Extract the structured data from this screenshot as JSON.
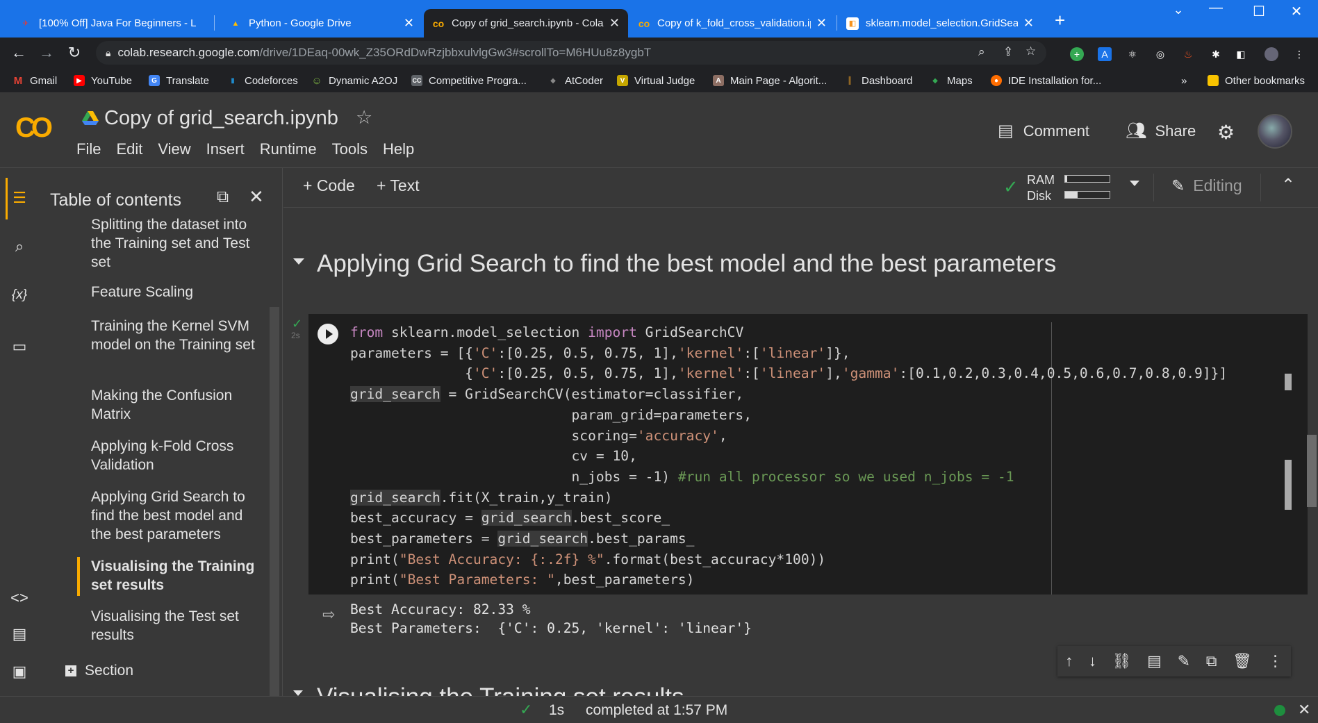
{
  "browser": {
    "tabs": [
      {
        "title": "[100% Off] Java For Beginners - L",
        "icon": "udemy-icon",
        "color": "#e53935",
        "glyph": "✈"
      },
      {
        "title": "Python - Google Drive",
        "icon": "google-drive-icon",
        "color": "#fbbc04",
        "glyph": "▲"
      },
      {
        "title": "Copy of grid_search.ipynb - Colab",
        "icon": "colab-icon",
        "color": "#f9ab00",
        "glyph": "co"
      },
      {
        "title": "Copy of k_fold_cross_validation.ip",
        "icon": "colab-icon",
        "color": "#f9ab00",
        "glyph": "co"
      },
      {
        "title": "sklearn.model_selection.GridSear",
        "icon": "sklearn-icon",
        "color": "#f7931e",
        "glyph": "◧"
      }
    ],
    "url_host": "colab.research.google.com",
    "url_path": "/drive/1DEaq-00wk_Z35ORdDwRzjbbxulvlgGw3#scrollTo=M6HUu8z8ygbT",
    "bookmarks": [
      {
        "label": "Gmail",
        "icon": "gmail-icon",
        "color": "#ea4335",
        "glyph": "M"
      },
      {
        "label": "YouTube",
        "icon": "youtube-icon",
        "color": "#ff0000",
        "glyph": "▶"
      },
      {
        "label": "Translate",
        "icon": "translate-icon",
        "color": "#4285f4",
        "glyph": "G"
      },
      {
        "label": "Codeforces",
        "icon": "codeforces-icon",
        "color": "#1f8acb",
        "glyph": "▮"
      },
      {
        "label": "Dynamic A2OJ",
        "icon": "a2oj-icon",
        "color": "#7cb342",
        "glyph": "☺"
      },
      {
        "label": "Competitive Progra...",
        "icon": "cp-icon",
        "color": "#5f6368",
        "glyph": "CC"
      },
      {
        "label": "AtCoder",
        "icon": "atcoder-icon",
        "color": "#444",
        "glyph": "◆"
      },
      {
        "label": "Virtual Judge",
        "icon": "vjudge-icon",
        "color": "#c6a700",
        "glyph": "V"
      },
      {
        "label": "Main Page - Algorit...",
        "icon": "algorithmica-icon",
        "color": "#8d6e63",
        "glyph": "A"
      },
      {
        "label": "Dashboard",
        "icon": "dashboard-icon",
        "color": "#f9a825",
        "glyph": "║"
      },
      {
        "label": "Maps",
        "icon": "maps-icon",
        "color": "#34a853",
        "glyph": "◆"
      },
      {
        "label": "IDE Installation for...",
        "icon": "ide-icon",
        "color": "#ff6d00",
        "glyph": "●"
      }
    ],
    "bookmarks_more": "»",
    "other_bookmarks": "Other bookmarks"
  },
  "colab": {
    "notebook_title": "Copy of grid_search.ipynb",
    "menu": [
      "File",
      "Edit",
      "View",
      "Insert",
      "Runtime",
      "Tools",
      "Help"
    ],
    "comment_label": "Comment",
    "share_label": "Share",
    "add_code": "+ Code",
    "add_text": "+ Text",
    "ram_label": "RAM",
    "disk_label": "Disk",
    "ram_usage": 0.05,
    "disk_usage": 0.28,
    "editing_label": "Editing"
  },
  "toc": {
    "title": "Table of contents",
    "items": [
      "Splitting the dataset into the Training set and Test set",
      "Feature Scaling",
      "Training the Kernel SVM model on the Training set",
      "Making the Confusion Matrix",
      "Applying k-Fold Cross Validation",
      "Applying Grid Search to find the best model and the best parameters",
      "Visualising the Training set results",
      "Visualising the Test set results"
    ],
    "add_section": "Section"
  },
  "notebook": {
    "section_heading": "Applying Grid Search to find the best model and the best parameters",
    "exec_time": "2s",
    "output_lines": [
      "Best Accuracy: 82.33 %",
      "Best Parameters:  {'C': 0.25, 'kernel': 'linear'}"
    ],
    "next_heading": "Visualising the Training set results"
  },
  "status": {
    "elapsed": "1s",
    "message": "completed at 1:57 PM"
  }
}
